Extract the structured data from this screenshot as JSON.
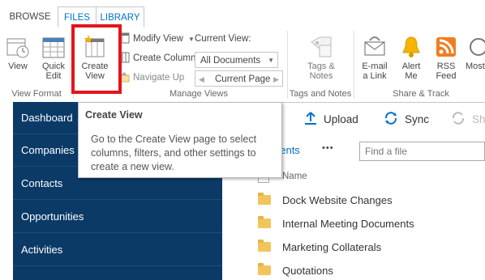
{
  "tabs": [
    {
      "label": "BROWSE",
      "active": false
    },
    {
      "label": "FILES",
      "active": true
    },
    {
      "label": "LIBRARY",
      "active": true
    }
  ],
  "ribbon": {
    "view_format": {
      "group_label": "View Format",
      "view_label": "View",
      "quick_edit_label": "Quick Edit"
    },
    "manage_views": {
      "group_label": "Manage Views",
      "create_view_label": "Create View",
      "modify_view_label": "Modify View",
      "create_column_label": "Create Column",
      "navigate_up_label": "Navigate Up",
      "current_view_label": "Current View:",
      "current_view_value": "All Documents",
      "current_page_label": "Current Page"
    },
    "tags_notes": {
      "group_label": "Tags and Notes",
      "tags_notes_label": "Tags & Notes"
    },
    "share_track": {
      "group_label": "Share & Track",
      "email_link_label": "E-mail a Link",
      "alert_me_label": "Alert Me",
      "rss_feed_label": "RSS Feed",
      "most_label": "Most Li"
    }
  },
  "tooltip": {
    "title": "Create View",
    "body": "Go to the Create View page to select columns, filters, and other settings to create a new view."
  },
  "left_nav": {
    "items": [
      "Dashboard",
      "Companies",
      "Contacts",
      "Opportunities",
      "Activities"
    ]
  },
  "commands": {
    "upload": "Upload",
    "sync": "Sync",
    "share": "Sha"
  },
  "library": {
    "view_link_partial": "nents",
    "more": "•••",
    "search_placeholder": "Find a file",
    "name_header": "Name",
    "folders": [
      "Dock Website Changes",
      "Internal Meeting Documents",
      "Marketing Collaterals",
      "Quotations"
    ]
  },
  "colors": {
    "nav_bg": "#0b3a67",
    "accent": "#0072c6",
    "highlight_box": "#e3141c",
    "folder": "#f2c55c"
  }
}
